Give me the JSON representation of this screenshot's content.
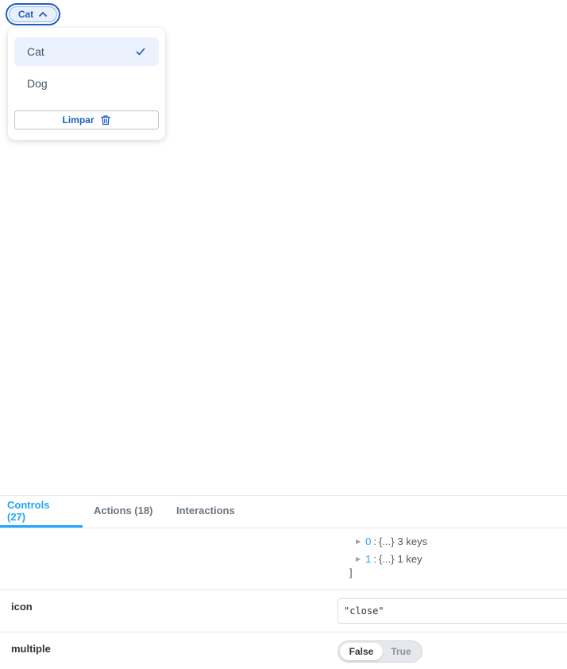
{
  "preview": {
    "chip_label": "Cat",
    "options": [
      {
        "label": "Cat",
        "selected": true
      },
      {
        "label": "Dog",
        "selected": false
      }
    ],
    "clear_label": "Limpar",
    "accent_color": "#1f5fbf"
  },
  "addons": {
    "tabs": [
      {
        "label": "Controls (27)",
        "active": true
      },
      {
        "label": "Actions (18)",
        "active": false
      },
      {
        "label": "Interactions",
        "active": false
      }
    ],
    "tree": [
      {
        "key": "0",
        "sep": ":",
        "obj": "{...}",
        "count": "3 keys"
      },
      {
        "key": "1",
        "sep": ":",
        "obj": "{...}",
        "count": "1 key"
      }
    ],
    "tree_close": "]",
    "controls": {
      "icon": {
        "label": "icon",
        "value": "\"close\""
      },
      "multiple": {
        "label": "multiple",
        "options": [
          "False",
          "True"
        ],
        "selected": "False"
      }
    },
    "active_tab_color": "#1ea7fd"
  }
}
